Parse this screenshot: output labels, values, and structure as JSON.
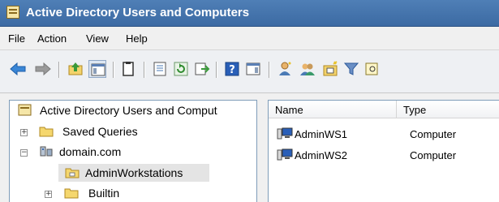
{
  "window": {
    "title": "Active Directory Users and Computers"
  },
  "menu": [
    "File",
    "Action",
    "View",
    "Help"
  ],
  "toolbar": {
    "buttons": [
      "back-icon",
      "forward-icon",
      "up-folder-icon",
      "show-console-tree-icon",
      "clipboard-icon",
      "properties-icon",
      "refresh-icon",
      "export-list-icon",
      "help-icon",
      "show-action-pane-icon",
      "new-user-icon",
      "new-group-icon",
      "new-ou-icon",
      "filter-icon",
      "find-icon"
    ]
  },
  "tree": {
    "root": "Active Directory Users and Comput",
    "items": [
      {
        "label": "Saved Queries",
        "expander": "+"
      },
      {
        "label": "domain.com",
        "expander": "−"
      },
      {
        "label": "AdminWorkstations",
        "selected": true
      },
      {
        "label": "Builtin",
        "expander": "+"
      }
    ]
  },
  "list": {
    "columns": [
      "Name",
      "Type"
    ],
    "rows": [
      {
        "name": "AdminWS1",
        "type": "Computer"
      },
      {
        "name": "AdminWS2",
        "type": "Computer"
      }
    ]
  }
}
